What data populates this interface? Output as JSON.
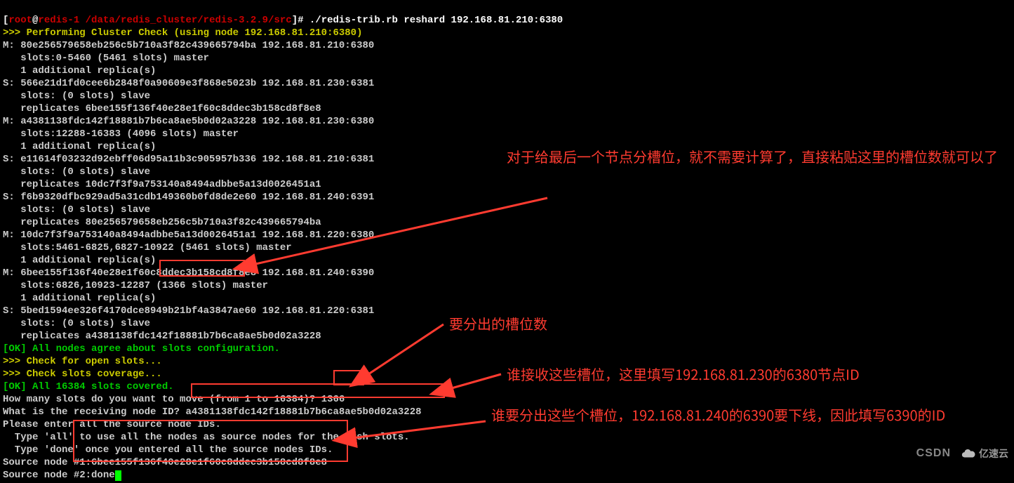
{
  "prompt": {
    "open": "[",
    "user": "root",
    "at": "@",
    "host": "redis-1 ",
    "path": "/data/redis_cluster/redis-3.2.9/src",
    "close": "]# ",
    "command": "./redis-trib.rb reshard 192.168.81.210:6380"
  },
  "lines": {
    "l1": ">>> Performing Cluster Check (using node 192.168.81.210:6380)",
    "l2": "M: 80e256579658eb256c5b710a3f82c439665794ba 192.168.81.210:6380",
    "l3": "   slots:0-5460 (5461 slots) master",
    "l4": "   1 additional replica(s)",
    "l5": "S: 566e21d1fd0cee6b2848f0a90609e3f868e5023b 192.168.81.230:6381",
    "l6": "   slots: (0 slots) slave",
    "l7": "   replicates 6bee155f136f40e28e1f60c8ddec3b158cd8f8e8",
    "l8": "M: a4381138fdc142f18881b7b6ca8ae5b0d02a3228 192.168.81.230:6380",
    "l9": "   slots:12288-16383 (4096 slots) master",
    "l10": "   1 additional replica(s)",
    "l11": "S: e11614f03232d92ebff06d95a11b3c905957b336 192.168.81.210:6381",
    "l12": "   slots: (0 slots) slave",
    "l13": "   replicates 10dc7f3f9a753140a8494adbbe5a13d0026451a1",
    "l14": "S: f6b9320dfbc929ad5a31cdb149360b0fd8de2e60 192.168.81.240:6391",
    "l15": "   slots: (0 slots) slave",
    "l16": "   replicates 80e256579658eb256c5b710a3f82c439665794ba",
    "l17": "M: 10dc7f3f9a753140a8494adbbe5a13d0026451a1 192.168.81.220:6380",
    "l18": "   slots:5461-6825,6827-10922 (5461 slots) master",
    "l19": "   1 additional replica(s)",
    "l20": "M: 6bee155f136f40e28e1f60c8ddec3b158cd8f8e8 192.168.81.240:6390",
    "l21": "   slots:6826,10923-12287 (1366 slots) master",
    "l22": "   1 additional replica(s)",
    "l23": "S: 5bed1594ee326f4170dce8949b21bf4a3847ae60 192.168.81.220:6381",
    "l24": "   slots: (0 slots) slave",
    "l25": "   replicates a4381138fdc142f18881b7b6ca8ae5b0d02a3228",
    "l26ok": "[OK] All nodes agree about slots configuration.",
    "l27": ">>> Check for open slots...",
    "l28": ">>> Check slots coverage...",
    "l29ok": "[OK] All 16384 slots covered.",
    "l30": "How many slots do you want to move (from 1 to 16384)? 1366",
    "l31": "What is the receiving node ID? a4381138fdc142f18881b7b6ca8ae5b0d02a3228",
    "l32": "Please enter all the source node IDs.",
    "l33": "  Type 'all' to use all the nodes as source nodes for the hash slots.",
    "l34": "  Type 'done' once you entered all the source nodes IDs.",
    "l35": "Source node #1:6bee155f136f40e28e1f60c8ddec3b158cd8f8e8",
    "l36": "Source node #2:done"
  },
  "annotations": {
    "a1": "对于给最后一个节点分槽位，就不需要计算了，直接粘贴这里的槽位数就可以了",
    "a2": "要分出的槽位数",
    "a3": "谁接收这些槽位，这里填写192.168.81.230的6380节点ID",
    "a4": "谁要分出这些个槽位，192.168.81.240的6390要下线，因此填写6390的ID"
  },
  "watermark": "CSDN",
  "logo_text": "亿速云"
}
